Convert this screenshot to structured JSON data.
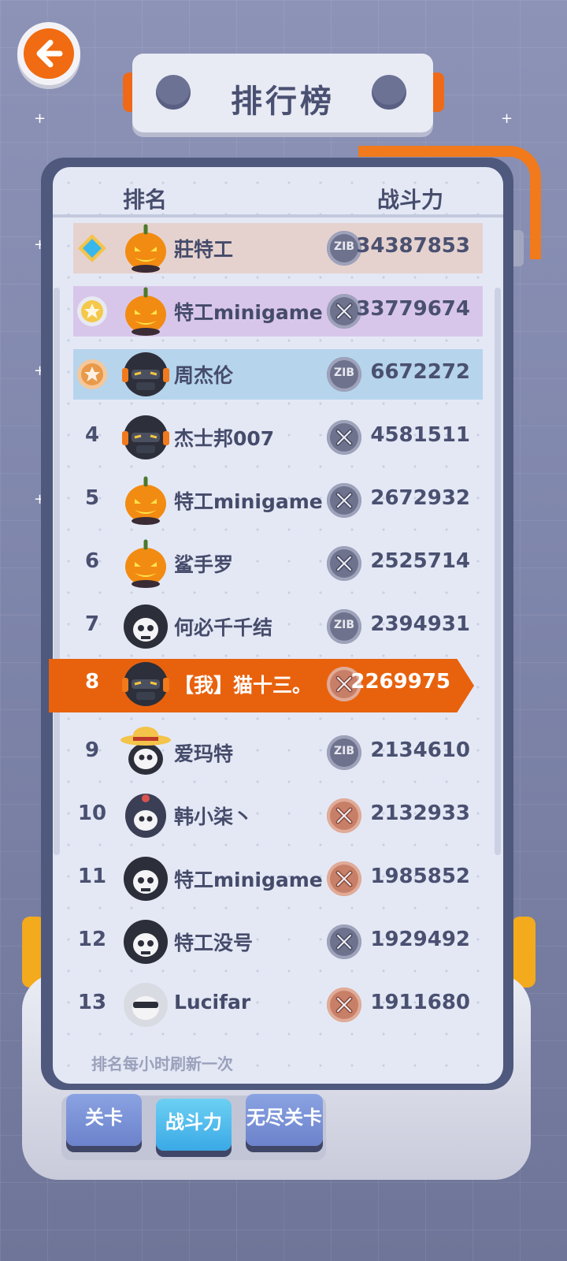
{
  "title": "排行榜",
  "header": {
    "rank_label": "排名",
    "power_label": "战斗力"
  },
  "rows": [
    {
      "rank": "",
      "medal": "diamond",
      "avatar": "pumpkin",
      "name": "莊特工",
      "coin": "ZIB",
      "power": "34387853"
    },
    {
      "rank": "",
      "medal": "gold-star",
      "avatar": "pumpkin",
      "name": "特工minigame",
      "coin": "X",
      "power": "33779674"
    },
    {
      "rank": "",
      "medal": "bronze-star",
      "avatar": "helmet",
      "name": "周杰伦",
      "coin": "ZIB",
      "power": "6672272"
    },
    {
      "rank": "4",
      "avatar": "helmet",
      "name": "杰士邦007",
      "coin": "X",
      "power": "4581511"
    },
    {
      "rank": "5",
      "avatar": "pumpkin",
      "name": "特工minigame",
      "coin": "X",
      "power": "2672932"
    },
    {
      "rank": "6",
      "avatar": "pumpkin",
      "name": "鲨手罗",
      "coin": "X",
      "power": "2525714"
    },
    {
      "rank": "7",
      "avatar": "skull-hood",
      "name": "何必千千结",
      "coin": "ZIB",
      "power": "2394931"
    },
    {
      "rank": "8",
      "avatar": "helmet",
      "name": "【我】猫十三。",
      "coin": "X-bronze",
      "power": "2269975"
    },
    {
      "rank": "9",
      "avatar": "skull-straw-hat",
      "name": "爱玛特",
      "coin": "ZIB",
      "power": "2134610"
    },
    {
      "rank": "10",
      "avatar": "skull-helmet",
      "name": "韩小柒丶",
      "coin": "X-bronze",
      "power": "2132933"
    },
    {
      "rank": "11",
      "avatar": "skull-hood",
      "name": "特工minigame",
      "coin": "X-bronze",
      "power": "1985852"
    },
    {
      "rank": "12",
      "avatar": "skull-hood",
      "name": "特工没号",
      "coin": "X",
      "power": "1929492"
    },
    {
      "rank": "13",
      "avatar": "skull-white-hood",
      "name": "Lucifar",
      "coin": "X-bronze",
      "power": "1911680"
    }
  ],
  "footer_note": "排名每小时刷新一次",
  "tabs": [
    {
      "label": "关卡",
      "active": false
    },
    {
      "label": "战斗力",
      "active": true
    },
    {
      "label": "无尽关卡",
      "active": false
    }
  ],
  "colors": {
    "accent": "#e8620e",
    "panel": "#4f587d",
    "active_tab": "#3aa9e6"
  }
}
